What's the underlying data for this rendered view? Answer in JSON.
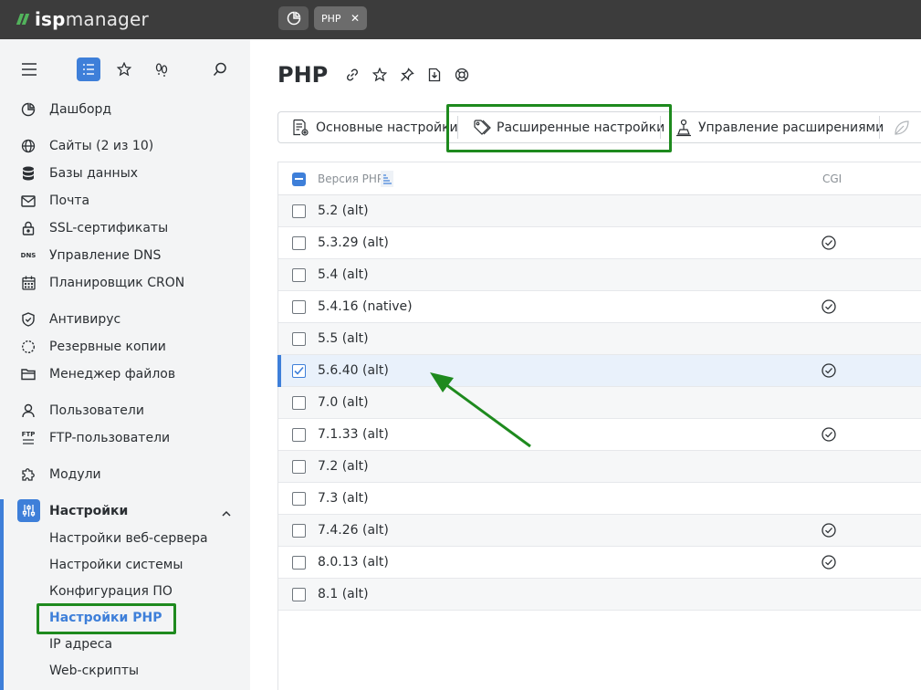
{
  "topbar": {
    "logo_prefix": "isp",
    "logo_suffix": "manager",
    "tab_label": "PHP",
    "tab_close": "✕"
  },
  "sidebar": {
    "items": [
      {
        "label": "Дашборд",
        "icon": "dashboard-icon"
      },
      {
        "label": "Сайты (2 из 10)",
        "icon": "globe-icon"
      },
      {
        "label": "Базы данных",
        "icon": "database-icon"
      },
      {
        "label": "Почта",
        "icon": "mail-icon"
      },
      {
        "label": "SSL-сертификаты",
        "icon": "lock-icon"
      },
      {
        "label": "Управление DNS",
        "icon": "dns-icon"
      },
      {
        "label": "Планировщик CRON",
        "icon": "calendar-icon"
      },
      {
        "label": "Антивирус",
        "icon": "shield-icon"
      },
      {
        "label": "Резервные копии",
        "icon": "backup-icon"
      },
      {
        "label": "Менеджер файлов",
        "icon": "folder-icon"
      },
      {
        "label": "Пользователи",
        "icon": "user-icon"
      },
      {
        "label": "FTP-пользователи",
        "icon": "ftp-icon"
      },
      {
        "label": "Модули",
        "icon": "puzzle-icon"
      }
    ],
    "settings": {
      "label": "Настройки",
      "subitems": [
        "Настройки веб-сервера",
        "Настройки системы",
        "Конфигурация ПО",
        "Настройки PHP",
        "IP адреса",
        "Web-скрипты"
      ],
      "active": "Настройки PHP"
    },
    "dns_icon_text": "DNS",
    "ftp_icon_text": "FTP"
  },
  "main": {
    "title": "PHP",
    "toolbar": {
      "basic": "Основные настройки",
      "advanced": "Расширенные настройки",
      "extensions": "Управление расширениями"
    },
    "table": {
      "col_version": "Версия PHP",
      "col_cgi": "CGI",
      "rows": [
        {
          "version": "5.2 (alt)",
          "cgi": false,
          "checked": false
        },
        {
          "version": "5.3.29 (alt)",
          "cgi": true,
          "checked": false
        },
        {
          "version": "5.4 (alt)",
          "cgi": false,
          "checked": false
        },
        {
          "version": "5.4.16 (native)",
          "cgi": true,
          "checked": false
        },
        {
          "version": "5.5 (alt)",
          "cgi": false,
          "checked": false
        },
        {
          "version": "5.6.40 (alt)",
          "cgi": true,
          "checked": true
        },
        {
          "version": "7.0 (alt)",
          "cgi": false,
          "checked": false
        },
        {
          "version": "7.1.33 (alt)",
          "cgi": true,
          "checked": false
        },
        {
          "version": "7.2 (alt)",
          "cgi": false,
          "checked": false
        },
        {
          "version": "7.3 (alt)",
          "cgi": false,
          "checked": false
        },
        {
          "version": "7.4.26 (alt)",
          "cgi": true,
          "checked": false
        },
        {
          "version": "8.0.13 (alt)",
          "cgi": true,
          "checked": false
        },
        {
          "version": "8.1 (alt)",
          "cgi": false,
          "checked": false
        }
      ]
    }
  },
  "colors": {
    "accent": "#3e7fd9",
    "highlight": "#1e8a1e",
    "topbar": "#3c3c3c",
    "sidebar": "#f3f4f5"
  }
}
